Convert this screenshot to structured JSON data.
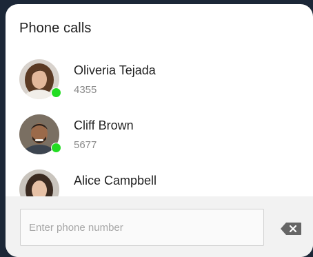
{
  "panel": {
    "title": "Phone calls"
  },
  "contacts": [
    {
      "name": "Oliveria Tejada",
      "number": "4355",
      "status": "online",
      "avatar": "avatar-woman-brown-hair"
    },
    {
      "name": "Cliff Brown",
      "number": "5677",
      "status": "online",
      "avatar": "avatar-man-beard"
    },
    {
      "name": "Alice Campbell",
      "number": "",
      "status": "",
      "avatar": "avatar-woman-dark-hair"
    }
  ],
  "input": {
    "placeholder": "Enter phone number",
    "value": ""
  },
  "icons": {
    "backspace": "backspace-icon"
  },
  "colors": {
    "background": "#1c2737",
    "panel": "#ffffff",
    "footer": "#f2f2f2",
    "online": "#22dd22",
    "name_text": "#1f1f1f",
    "number_text": "#8a8a8a",
    "backspace_icon": "#666666"
  }
}
